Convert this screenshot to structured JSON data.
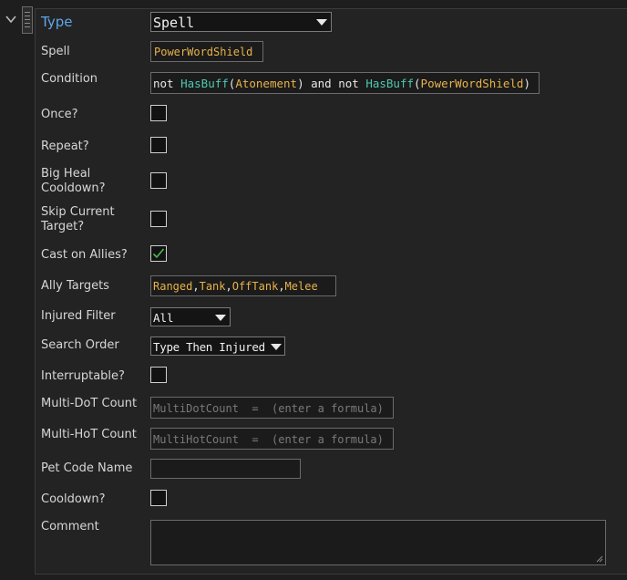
{
  "fields": {
    "type": {
      "label": "Type",
      "value": "Spell"
    },
    "spell": {
      "label": "Spell",
      "value": "PowerWordShield"
    },
    "condition": {
      "label": "Condition",
      "tokens": [
        {
          "text": "not ",
          "kind": "white"
        },
        {
          "text": "HasBuff",
          "kind": "teal"
        },
        {
          "text": "(",
          "kind": "white"
        },
        {
          "text": "Atonement",
          "kind": "orange"
        },
        {
          "text": ") and not ",
          "kind": "white"
        },
        {
          "text": "HasBuff",
          "kind": "teal"
        },
        {
          "text": "(",
          "kind": "white"
        },
        {
          "text": "PowerWordShield",
          "kind": "orange"
        },
        {
          "text": ")",
          "kind": "white"
        }
      ]
    },
    "once": {
      "label": "Once?",
      "checked": false
    },
    "repeat": {
      "label": "Repeat?",
      "checked": false
    },
    "big_heal": {
      "label_line1": "Big Heal",
      "label_line2": "Cooldown?",
      "checked": false
    },
    "skip_target": {
      "label_line1": "Skip Current",
      "label_line2": "Target?",
      "checked": false
    },
    "cast_allies": {
      "label": "Cast on Allies?",
      "checked": true
    },
    "ally_targets": {
      "label": "Ally Targets",
      "tokens": [
        {
          "text": "Ranged",
          "kind": "orange"
        },
        {
          "text": ",",
          "kind": "white"
        },
        {
          "text": "Tank",
          "kind": "orange"
        },
        {
          "text": ",",
          "kind": "white"
        },
        {
          "text": "OffTank",
          "kind": "orange"
        },
        {
          "text": ",",
          "kind": "white"
        },
        {
          "text": "Melee",
          "kind": "orange"
        }
      ]
    },
    "injured_filter": {
      "label": "Injured Filter",
      "value": "All"
    },
    "search_order": {
      "label": "Search Order",
      "value": "Type Then Injured"
    },
    "interruptable": {
      "label": "Interruptable?",
      "checked": false
    },
    "multi_dot": {
      "label": "Multi-DoT Count",
      "placeholder": "MultiDotCount  =  (enter a formula)"
    },
    "multi_hot": {
      "label": "Multi-HoT Count",
      "placeholder": "MultiHotCount  =  (enter a formula)"
    },
    "pet_code": {
      "label": "Pet Code Name",
      "value": ""
    },
    "cooldown": {
      "label": "Cooldown?",
      "checked": false
    },
    "comment": {
      "label": "Comment",
      "value": ""
    }
  },
  "icons": {
    "collapse": "chevron-down-icon",
    "drag": "drag-handle-icon",
    "check": "checkmark-icon",
    "resize": "resize-grip-icon"
  },
  "colors": {
    "label_accent": "#5ea6e8",
    "string": "#e8b24a",
    "function": "#4ec9b0",
    "check": "#4fb84f"
  }
}
